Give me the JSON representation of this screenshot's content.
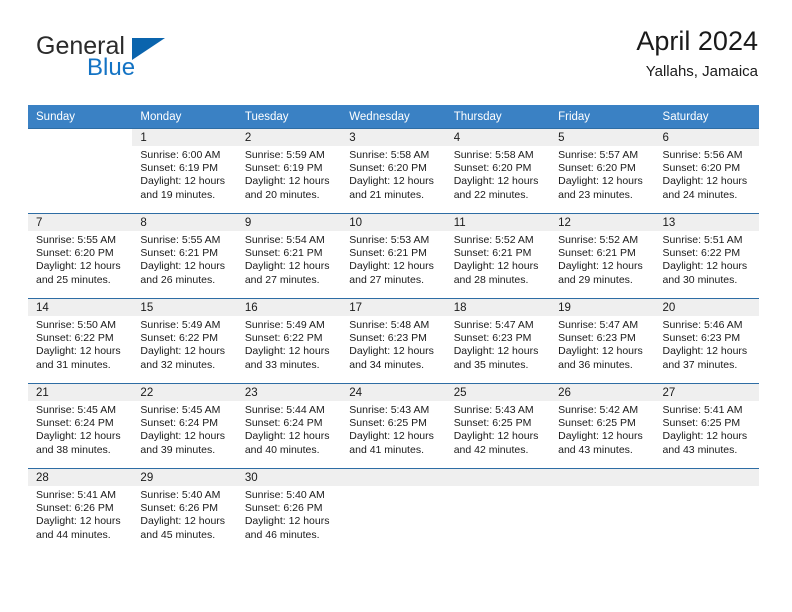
{
  "brand": {
    "name_top": "General",
    "name_bottom": "Blue",
    "triangle_icon": "blue-triangle-icon",
    "color_top": "#2b2b2b",
    "color_bottom": "#1373c4"
  },
  "header": {
    "title": "April 2024",
    "subtitle": "Yallahs, Jamaica"
  },
  "colors": {
    "header_row_bg": "#3a81c4",
    "header_row_text": "#ffffff",
    "daynum_band_bg": "#efefef",
    "row_border": "#2e6da4",
    "cell_bg": "#ffffff",
    "text": "#1a1a1a"
  },
  "calendar": {
    "weekday_headers": [
      "Sunday",
      "Monday",
      "Tuesday",
      "Wednesday",
      "Thursday",
      "Friday",
      "Saturday"
    ],
    "weeks": [
      [
        {
          "day": "",
          "blank": true,
          "sunrise": "",
          "sunset": "",
          "daylight_line1": "",
          "daylight_line2": ""
        },
        {
          "day": "1",
          "sunrise": "Sunrise: 6:00 AM",
          "sunset": "Sunset: 6:19 PM",
          "daylight_line1": "Daylight: 12 hours",
          "daylight_line2": "and 19 minutes."
        },
        {
          "day": "2",
          "sunrise": "Sunrise: 5:59 AM",
          "sunset": "Sunset: 6:19 PM",
          "daylight_line1": "Daylight: 12 hours",
          "daylight_line2": "and 20 minutes."
        },
        {
          "day": "3",
          "sunrise": "Sunrise: 5:58 AM",
          "sunset": "Sunset: 6:20 PM",
          "daylight_line1": "Daylight: 12 hours",
          "daylight_line2": "and 21 minutes."
        },
        {
          "day": "4",
          "sunrise": "Sunrise: 5:58 AM",
          "sunset": "Sunset: 6:20 PM",
          "daylight_line1": "Daylight: 12 hours",
          "daylight_line2": "and 22 minutes."
        },
        {
          "day": "5",
          "sunrise": "Sunrise: 5:57 AM",
          "sunset": "Sunset: 6:20 PM",
          "daylight_line1": "Daylight: 12 hours",
          "daylight_line2": "and 23 minutes."
        },
        {
          "day": "6",
          "sunrise": "Sunrise: 5:56 AM",
          "sunset": "Sunset: 6:20 PM",
          "daylight_line1": "Daylight: 12 hours",
          "daylight_line2": "and 24 minutes."
        }
      ],
      [
        {
          "day": "7",
          "sunrise": "Sunrise: 5:55 AM",
          "sunset": "Sunset: 6:20 PM",
          "daylight_line1": "Daylight: 12 hours",
          "daylight_line2": "and 25 minutes."
        },
        {
          "day": "8",
          "sunrise": "Sunrise: 5:55 AM",
          "sunset": "Sunset: 6:21 PM",
          "daylight_line1": "Daylight: 12 hours",
          "daylight_line2": "and 26 minutes."
        },
        {
          "day": "9",
          "sunrise": "Sunrise: 5:54 AM",
          "sunset": "Sunset: 6:21 PM",
          "daylight_line1": "Daylight: 12 hours",
          "daylight_line2": "and 27 minutes."
        },
        {
          "day": "10",
          "sunrise": "Sunrise: 5:53 AM",
          "sunset": "Sunset: 6:21 PM",
          "daylight_line1": "Daylight: 12 hours",
          "daylight_line2": "and 27 minutes."
        },
        {
          "day": "11",
          "sunrise": "Sunrise: 5:52 AM",
          "sunset": "Sunset: 6:21 PM",
          "daylight_line1": "Daylight: 12 hours",
          "daylight_line2": "and 28 minutes."
        },
        {
          "day": "12",
          "sunrise": "Sunrise: 5:52 AM",
          "sunset": "Sunset: 6:21 PM",
          "daylight_line1": "Daylight: 12 hours",
          "daylight_line2": "and 29 minutes."
        },
        {
          "day": "13",
          "sunrise": "Sunrise: 5:51 AM",
          "sunset": "Sunset: 6:22 PM",
          "daylight_line1": "Daylight: 12 hours",
          "daylight_line2": "and 30 minutes."
        }
      ],
      [
        {
          "day": "14",
          "sunrise": "Sunrise: 5:50 AM",
          "sunset": "Sunset: 6:22 PM",
          "daylight_line1": "Daylight: 12 hours",
          "daylight_line2": "and 31 minutes."
        },
        {
          "day": "15",
          "sunrise": "Sunrise: 5:49 AM",
          "sunset": "Sunset: 6:22 PM",
          "daylight_line1": "Daylight: 12 hours",
          "daylight_line2": "and 32 minutes."
        },
        {
          "day": "16",
          "sunrise": "Sunrise: 5:49 AM",
          "sunset": "Sunset: 6:22 PM",
          "daylight_line1": "Daylight: 12 hours",
          "daylight_line2": "and 33 minutes."
        },
        {
          "day": "17",
          "sunrise": "Sunrise: 5:48 AM",
          "sunset": "Sunset: 6:23 PM",
          "daylight_line1": "Daylight: 12 hours",
          "daylight_line2": "and 34 minutes."
        },
        {
          "day": "18",
          "sunrise": "Sunrise: 5:47 AM",
          "sunset": "Sunset: 6:23 PM",
          "daylight_line1": "Daylight: 12 hours",
          "daylight_line2": "and 35 minutes."
        },
        {
          "day": "19",
          "sunrise": "Sunrise: 5:47 AM",
          "sunset": "Sunset: 6:23 PM",
          "daylight_line1": "Daylight: 12 hours",
          "daylight_line2": "and 36 minutes."
        },
        {
          "day": "20",
          "sunrise": "Sunrise: 5:46 AM",
          "sunset": "Sunset: 6:23 PM",
          "daylight_line1": "Daylight: 12 hours",
          "daylight_line2": "and 37 minutes."
        }
      ],
      [
        {
          "day": "21",
          "sunrise": "Sunrise: 5:45 AM",
          "sunset": "Sunset: 6:24 PM",
          "daylight_line1": "Daylight: 12 hours",
          "daylight_line2": "and 38 minutes."
        },
        {
          "day": "22",
          "sunrise": "Sunrise: 5:45 AM",
          "sunset": "Sunset: 6:24 PM",
          "daylight_line1": "Daylight: 12 hours",
          "daylight_line2": "and 39 minutes."
        },
        {
          "day": "23",
          "sunrise": "Sunrise: 5:44 AM",
          "sunset": "Sunset: 6:24 PM",
          "daylight_line1": "Daylight: 12 hours",
          "daylight_line2": "and 40 minutes."
        },
        {
          "day": "24",
          "sunrise": "Sunrise: 5:43 AM",
          "sunset": "Sunset: 6:25 PM",
          "daylight_line1": "Daylight: 12 hours",
          "daylight_line2": "and 41 minutes."
        },
        {
          "day": "25",
          "sunrise": "Sunrise: 5:43 AM",
          "sunset": "Sunset: 6:25 PM",
          "daylight_line1": "Daylight: 12 hours",
          "daylight_line2": "and 42 minutes."
        },
        {
          "day": "26",
          "sunrise": "Sunrise: 5:42 AM",
          "sunset": "Sunset: 6:25 PM",
          "daylight_line1": "Daylight: 12 hours",
          "daylight_line2": "and 43 minutes."
        },
        {
          "day": "27",
          "sunrise": "Sunrise: 5:41 AM",
          "sunset": "Sunset: 6:25 PM",
          "daylight_line1": "Daylight: 12 hours",
          "daylight_line2": "and 43 minutes."
        }
      ],
      [
        {
          "day": "28",
          "sunrise": "Sunrise: 5:41 AM",
          "sunset": "Sunset: 6:26 PM",
          "daylight_line1": "Daylight: 12 hours",
          "daylight_line2": "and 44 minutes."
        },
        {
          "day": "29",
          "sunrise": "Sunrise: 5:40 AM",
          "sunset": "Sunset: 6:26 PM",
          "daylight_line1": "Daylight: 12 hours",
          "daylight_line2": "and 45 minutes."
        },
        {
          "day": "30",
          "sunrise": "Sunrise: 5:40 AM",
          "sunset": "Sunset: 6:26 PM",
          "daylight_line1": "Daylight: 12 hours",
          "daylight_line2": "and 46 minutes."
        },
        {
          "day": "",
          "sunrise": "",
          "sunset": "",
          "daylight_line1": "",
          "daylight_line2": ""
        },
        {
          "day": "",
          "sunrise": "",
          "sunset": "",
          "daylight_line1": "",
          "daylight_line2": ""
        },
        {
          "day": "",
          "sunrise": "",
          "sunset": "",
          "daylight_line1": "",
          "daylight_line2": ""
        },
        {
          "day": "",
          "sunrise": "",
          "sunset": "",
          "daylight_line1": "",
          "daylight_line2": ""
        }
      ]
    ]
  }
}
